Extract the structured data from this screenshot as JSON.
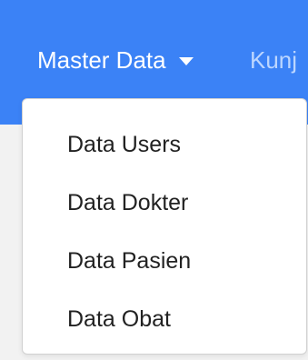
{
  "navbar": {
    "active_item": {
      "label": "Master Data",
      "icon": "caret-down-icon"
    },
    "next_item_partial": "Kunj"
  },
  "dropdown": {
    "items": [
      {
        "label": "Data Users"
      },
      {
        "label": "Data Dokter"
      },
      {
        "label": "Data Pasien"
      },
      {
        "label": "Data Obat"
      }
    ]
  },
  "colors": {
    "navbar_bg": "#3b82f6",
    "text": "#222222",
    "dropdown_bg": "#ffffff"
  }
}
